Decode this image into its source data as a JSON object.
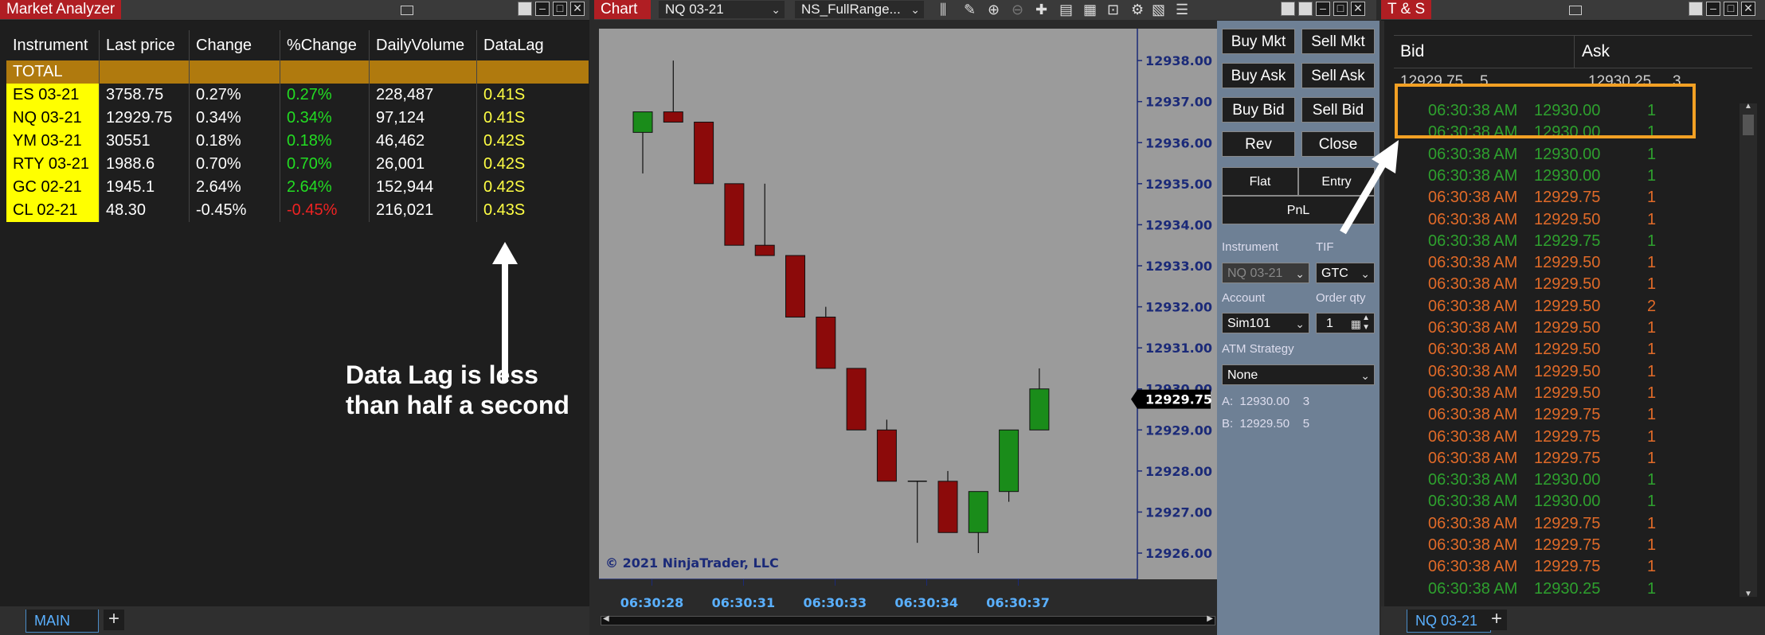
{
  "market_analyzer": {
    "title": "Market Analyzer",
    "columns": [
      "Instrument",
      "Last price",
      "Change",
      "%Change",
      "DailyVolume",
      "DataLag"
    ],
    "total_label": "TOTAL",
    "rows": [
      {
        "instrument": "ES 03-21",
        "last": "3758.75",
        "change": "0.27%",
        "pct": "0.27%",
        "volume": "228,487",
        "lag": "0.41S",
        "dir": "pos"
      },
      {
        "instrument": "NQ 03-21",
        "last": "12929.75",
        "change": "0.34%",
        "pct": "0.34%",
        "volume": "97,124",
        "lag": "0.41S",
        "dir": "pos"
      },
      {
        "instrument": "YM 03-21",
        "last": "30551",
        "change": "0.18%",
        "pct": "0.18%",
        "volume": "46,462",
        "lag": "0.42S",
        "dir": "pos"
      },
      {
        "instrument": "RTY 03-21",
        "last": "1988.6",
        "change": "0.70%",
        "pct": "0.70%",
        "volume": "26,001",
        "lag": "0.42S",
        "dir": "pos"
      },
      {
        "instrument": "GC 02-21",
        "last": "1945.1",
        "change": "2.64%",
        "pct": "2.64%",
        "volume": "152,944",
        "lag": "0.42S",
        "dir": "pos"
      },
      {
        "instrument": "CL 02-21",
        "last": "48.30",
        "change": "-0.45%",
        "pct": "-0.45%",
        "volume": "216,021",
        "lag": "0.43S",
        "dir": "neg"
      }
    ],
    "annotation_line1": "Data Lag is less",
    "annotation_line2": "than half a second",
    "tab_label": "MAIN",
    "add_tab": "+"
  },
  "chart": {
    "title": "Chart",
    "instrument_select": "NQ 03-21",
    "template_select": "NS_FullRange...",
    "copyright": "© 2021 NinjaTrader, LLC",
    "price_marker": "12929.75",
    "colors": {
      "up": "#1a8c1a",
      "down": "#8c0a0a",
      "axis": "#1b2a78",
      "background": "#9b9b9b"
    }
  },
  "chart_data": {
    "type": "candlestick",
    "y_ticks": [
      "12938.00",
      "12937.00",
      "12936.00",
      "12935.00",
      "12934.00",
      "12933.00",
      "12932.00",
      "12931.00",
      "12930.00",
      "12929.00",
      "12928.00",
      "12927.00",
      "12926.00"
    ],
    "ylim": [
      12925.4,
      12938.7
    ],
    "x_ticks": [
      {
        "label": "06:30:28",
        "index": 0.3
      },
      {
        "label": "06:30:31",
        "index": 3.3
      },
      {
        "label": "06:30:33",
        "index": 6.3
      },
      {
        "label": "06:30:34",
        "index": 9.3
      },
      {
        "label": "06:30:37",
        "index": 12.3
      }
    ],
    "candles": [
      {
        "o": 12936.25,
        "h": 12936.75,
        "l": 12935.25,
        "c": 12936.75
      },
      {
        "o": 12936.75,
        "h": 12938.0,
        "l": 12936.5,
        "c": 12936.5
      },
      {
        "o": 12936.5,
        "h": 12936.5,
        "l": 12935.0,
        "c": 12935.0
      },
      {
        "o": 12935.0,
        "h": 12935.0,
        "l": 12933.5,
        "c": 12933.5
      },
      {
        "o": 12933.5,
        "h": 12935.0,
        "l": 12933.25,
        "c": 12933.25
      },
      {
        "o": 12933.25,
        "h": 12933.25,
        "l": 12931.75,
        "c": 12931.75
      },
      {
        "o": 12931.75,
        "h": 12932.0,
        "l": 12930.5,
        "c": 12930.5
      },
      {
        "o": 12930.5,
        "h": 12930.5,
        "l": 12929.0,
        "c": 12929.0
      },
      {
        "o": 12929.0,
        "h": 12929.25,
        "l": 12927.75,
        "c": 12927.75
      },
      {
        "o": 12927.75,
        "h": 12927.75,
        "l": 12926.25,
        "c": 12927.75
      },
      {
        "o": 12927.75,
        "h": 12928.0,
        "l": 12926.5,
        "c": 12926.5
      },
      {
        "o": 12926.5,
        "h": 12927.5,
        "l": 12926.0,
        "c": 12927.5
      },
      {
        "o": 12927.5,
        "h": 12929.0,
        "l": 12927.25,
        "c": 12929.0
      },
      {
        "o": 12929.0,
        "h": 12930.5,
        "l": 12929.0,
        "c": 12930.0
      }
    ]
  },
  "trader": {
    "buy_mkt": "Buy Mkt",
    "sell_mkt": "Sell Mkt",
    "buy_ask": "Buy Ask",
    "sell_ask": "Sell Ask",
    "buy_bid": "Buy Bid",
    "sell_bid": "Sell Bid",
    "rev": "Rev",
    "close": "Close",
    "flat": "Flat",
    "entry": "Entry",
    "pnl": "PnL",
    "instrument_label": "Instrument",
    "tif_label": "TIF",
    "instrument_value": "NQ 03-21",
    "tif_value": "GTC",
    "account_label": "Account",
    "order_qty_label": "Order qty",
    "account_value": "Sim101",
    "order_qty_value": "1",
    "atm_label": "ATM Strategy",
    "atm_value": "None",
    "ask_line_label": "A:",
    "ask_line_price": "12930.00",
    "ask_line_size": "3",
    "bid_line_label": "B:",
    "bid_line_price": "12929.50",
    "bid_line_size": "5"
  },
  "ts": {
    "title": "T & S",
    "bid_header": "Bid",
    "ask_header": "Ask",
    "bid_price": "12929.75",
    "bid_size": "5",
    "ask_price": "12930.25",
    "ask_size": "3",
    "tab_label": "NQ 03-21",
    "add_tab": "+",
    "rows": [
      {
        "time": "06:30:38 AM",
        "price": "12930.00",
        "size": "1",
        "c": "g"
      },
      {
        "time": "06:30:38 AM",
        "price": "12930.00",
        "size": "1",
        "c": "g"
      },
      {
        "time": "06:30:38 AM",
        "price": "12930.00",
        "size": "1",
        "c": "g"
      },
      {
        "time": "06:30:38 AM",
        "price": "12930.00",
        "size": "1",
        "c": "g"
      },
      {
        "time": "06:30:38 AM",
        "price": "12929.75",
        "size": "1",
        "c": "o"
      },
      {
        "time": "06:30:38 AM",
        "price": "12929.50",
        "size": "1",
        "c": "o"
      },
      {
        "time": "06:30:38 AM",
        "price": "12929.75",
        "size": "1",
        "c": "g"
      },
      {
        "time": "06:30:38 AM",
        "price": "12929.50",
        "size": "1",
        "c": "o"
      },
      {
        "time": "06:30:38 AM",
        "price": "12929.50",
        "size": "1",
        "c": "o"
      },
      {
        "time": "06:30:38 AM",
        "price": "12929.50",
        "size": "2",
        "c": "o"
      },
      {
        "time": "06:30:38 AM",
        "price": "12929.50",
        "size": "1",
        "c": "o"
      },
      {
        "time": "06:30:38 AM",
        "price": "12929.50",
        "size": "1",
        "c": "o"
      },
      {
        "time": "06:30:38 AM",
        "price": "12929.50",
        "size": "1",
        "c": "o"
      },
      {
        "time": "06:30:38 AM",
        "price": "12929.50",
        "size": "1",
        "c": "o"
      },
      {
        "time": "06:30:38 AM",
        "price": "12929.75",
        "size": "1",
        "c": "o"
      },
      {
        "time": "06:30:38 AM",
        "price": "12929.75",
        "size": "1",
        "c": "o"
      },
      {
        "time": "06:30:38 AM",
        "price": "12929.75",
        "size": "1",
        "c": "o"
      },
      {
        "time": "06:30:38 AM",
        "price": "12930.00",
        "size": "1",
        "c": "g"
      },
      {
        "time": "06:30:38 AM",
        "price": "12930.00",
        "size": "1",
        "c": "g"
      },
      {
        "time": "06:30:38 AM",
        "price": "12929.75",
        "size": "1",
        "c": "o"
      },
      {
        "time": "06:30:38 AM",
        "price": "12929.75",
        "size": "1",
        "c": "o"
      },
      {
        "time": "06:30:38 AM",
        "price": "12929.75",
        "size": "1",
        "c": "o"
      },
      {
        "time": "06:30:38 AM",
        "price": "12930.25",
        "size": "1",
        "c": "g"
      }
    ]
  }
}
